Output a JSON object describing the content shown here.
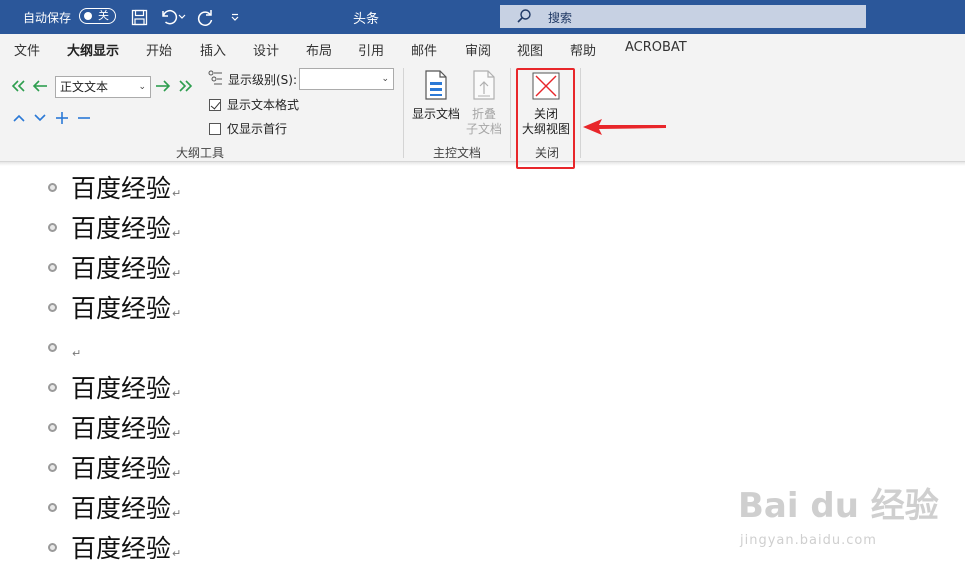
{
  "titlebar": {
    "autosave_label": "自动保存",
    "autosave_state": "关",
    "doc_title": "头条",
    "search_placeholder": "搜索"
  },
  "tabs": [
    {
      "label": "文件",
      "active": false
    },
    {
      "label": "大纲显示",
      "active": true
    },
    {
      "label": "开始",
      "active": false
    },
    {
      "label": "插入",
      "active": false
    },
    {
      "label": "设计",
      "active": false
    },
    {
      "label": "布局",
      "active": false
    },
    {
      "label": "引用",
      "active": false
    },
    {
      "label": "邮件",
      "active": false
    },
    {
      "label": "审阅",
      "active": false
    },
    {
      "label": "视图",
      "active": false
    },
    {
      "label": "帮助",
      "active": false
    },
    {
      "label": "ACROBAT",
      "active": false
    }
  ],
  "ribbon": {
    "outline_tools": {
      "level_select": "正文文本",
      "show_level_label": "显示级别(S):",
      "show_level_value": "",
      "show_text_format_label": "显示文本格式",
      "show_text_format_checked": true,
      "show_first_line_label": "仅显示首行",
      "show_first_line_checked": false,
      "group_label": "大纲工具"
    },
    "master_document": {
      "show_document_label": "显示文档",
      "collapse_subdocs_line1": "折叠",
      "collapse_subdocs_line2": "子文档",
      "group_label": "主控文档"
    },
    "close": {
      "close_outline_line1": "关闭",
      "close_outline_line2": "大纲视图",
      "group_label": "关闭"
    }
  },
  "document": {
    "items": [
      "百度经验",
      "百度经验",
      "百度经验",
      "百度经验",
      "",
      "百度经验",
      "百度经验",
      "百度经验",
      "百度经验",
      "百度经验"
    ],
    "paragraph_mark": "↵"
  },
  "watermark": {
    "main": "Bai du 经验",
    "sub": "jingyan.baidu.com"
  },
  "colors": {
    "titlebar": "#2b579a",
    "ribbon": "#f3f3f3",
    "highlight": "#e8262a",
    "arrow_green": "#2e9e4f",
    "arrow_blue": "#2b79d6"
  }
}
